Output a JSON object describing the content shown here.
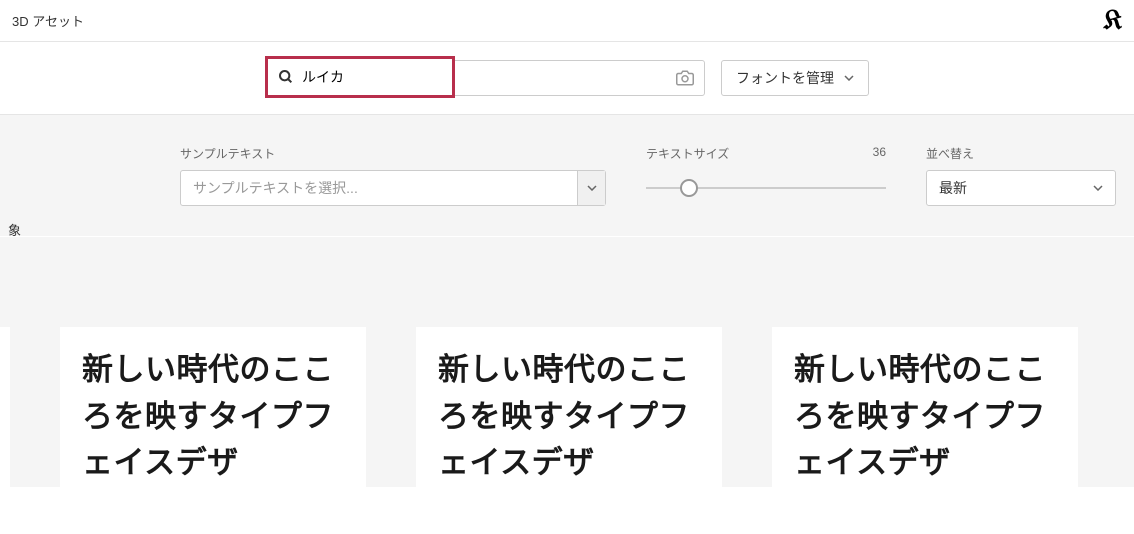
{
  "topbar": {
    "left_label": "3D アセット",
    "logo_glyph": "𝔎"
  },
  "search": {
    "value": "ルイカ",
    "manage_label": "フォントを管理"
  },
  "controls": {
    "sample_text": {
      "label": "サンプルテキスト",
      "placeholder": "サンプルテキストを選択..."
    },
    "text_size": {
      "label": "テキストサイズ",
      "value": "36"
    },
    "sort": {
      "label": "並べ替え",
      "selected": "最新"
    },
    "left_truncated": "象"
  },
  "font_cards": [
    {
      "preview": "新しい時代のこころを映すタイプフェイスデザ"
    },
    {
      "preview": "新しい時代のこころを映すタイプフェイスデザ"
    },
    {
      "preview": "新しい時代のこころを映すタイプフェイスデザ"
    }
  ]
}
